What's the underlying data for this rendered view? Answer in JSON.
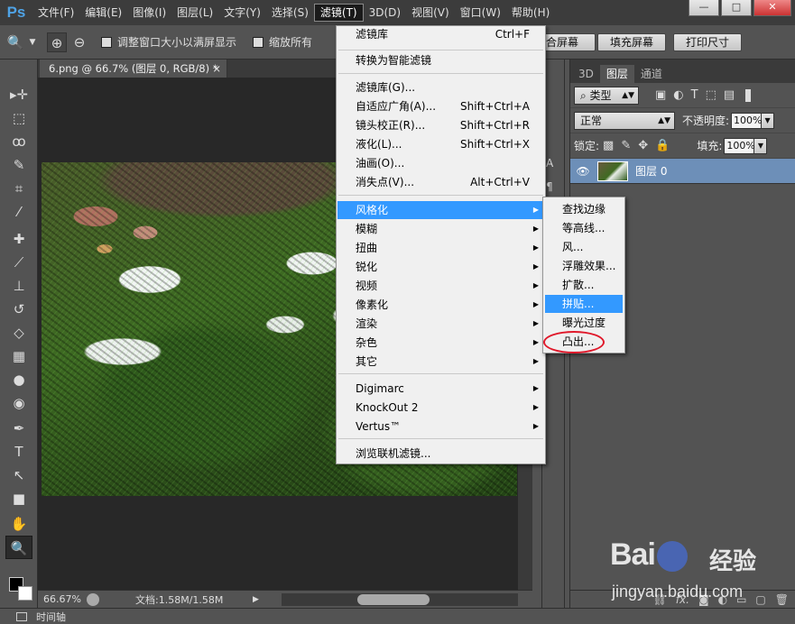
{
  "app": {
    "logo": "Ps"
  },
  "menubar": {
    "items": [
      "文件(F)",
      "编辑(E)",
      "图像(I)",
      "图层(L)",
      "文字(Y)",
      "选择(S)",
      "滤镜(T)",
      "3D(D)",
      "视图(V)",
      "窗口(W)",
      "帮助(H)"
    ],
    "active_index": 6
  },
  "window_controls": {
    "minimize": "—",
    "restore": "□",
    "close": "✕"
  },
  "options": {
    "fit_window_label": "调整窗口大小以满屏显示",
    "zoom_all_label": "缩放所有",
    "fit_screen_label": "合屏幕",
    "fill_screen_label": "填充屏幕",
    "print_size_label": "打印尺寸"
  },
  "document": {
    "tab_title": "6.png @ 66.7% (图层 0, RGB/8) *",
    "tab_close": "×",
    "zoom": "66.67%",
    "doc_size": "文档:1.58M/1.58M"
  },
  "timeline": {
    "label": "时间轴"
  },
  "filter_menu": {
    "items": [
      {
        "label": "滤镜库",
        "shortcut": "Ctrl+F"
      },
      {
        "label": "转换为智能滤镜",
        "shortcut": ""
      },
      {
        "label": "滤镜库(G)...",
        "shortcut": ""
      },
      {
        "label": "自适应广角(A)...",
        "shortcut": "Shift+Ctrl+A"
      },
      {
        "label": "镜头校正(R)...",
        "shortcut": "Shift+Ctrl+R"
      },
      {
        "label": "液化(L)...",
        "shortcut": "Shift+Ctrl+X"
      },
      {
        "label": "油画(O)...",
        "shortcut": ""
      },
      {
        "label": "消失点(V)...",
        "shortcut": "Alt+Ctrl+V"
      },
      {
        "label": "风格化",
        "shortcut": "",
        "submenu": true
      },
      {
        "label": "模糊",
        "shortcut": "",
        "submenu": true
      },
      {
        "label": "扭曲",
        "shortcut": "",
        "submenu": true
      },
      {
        "label": "锐化",
        "shortcut": "",
        "submenu": true
      },
      {
        "label": "视频",
        "shortcut": "",
        "submenu": true
      },
      {
        "label": "像素化",
        "shortcut": "",
        "submenu": true
      },
      {
        "label": "渲染",
        "shortcut": "",
        "submenu": true
      },
      {
        "label": "杂色",
        "shortcut": "",
        "submenu": true
      },
      {
        "label": "其它",
        "shortcut": "",
        "submenu": true
      },
      {
        "label": "Digimarc",
        "shortcut": "",
        "submenu": true
      },
      {
        "label": "KnockOut 2",
        "shortcut": "",
        "submenu": true
      },
      {
        "label": "Vertus™",
        "shortcut": "",
        "submenu": true
      },
      {
        "label": "浏览联机滤镜...",
        "shortcut": ""
      }
    ],
    "submenu_arrow": "▶"
  },
  "stylize_menu": {
    "items": [
      "查找边缘",
      "等高线...",
      "风...",
      "浮雕效果...",
      "扩散...",
      "拼贴...",
      "曝光过度",
      "凸出..."
    ],
    "highlight_index": 5
  },
  "layers_panel": {
    "tabs": [
      "3D",
      "图层",
      "通道"
    ],
    "active_tab": 1,
    "filter_kind": "类型",
    "blend_mode": "正常",
    "opacity_label": "不透明度:",
    "opacity_value": "100%",
    "lock_label": "锁定:",
    "fill_label": "填充:",
    "fill_value": "100%",
    "layer_name": "图层 0",
    "footer_icons": [
      "link-icon",
      "fx-icon",
      "mask-icon",
      "adjustment-icon",
      "folder-icon",
      "new-layer-icon",
      "trash-icon"
    ],
    "footer_fx": "fx."
  },
  "watermark": {
    "logo": "Bai",
    "text": "经验",
    "url": "jingyan.baidu.com"
  },
  "colors": {
    "accent": "#3399ff",
    "ellipse": "#e0182a",
    "ps_blue": "#4fa3e6"
  }
}
